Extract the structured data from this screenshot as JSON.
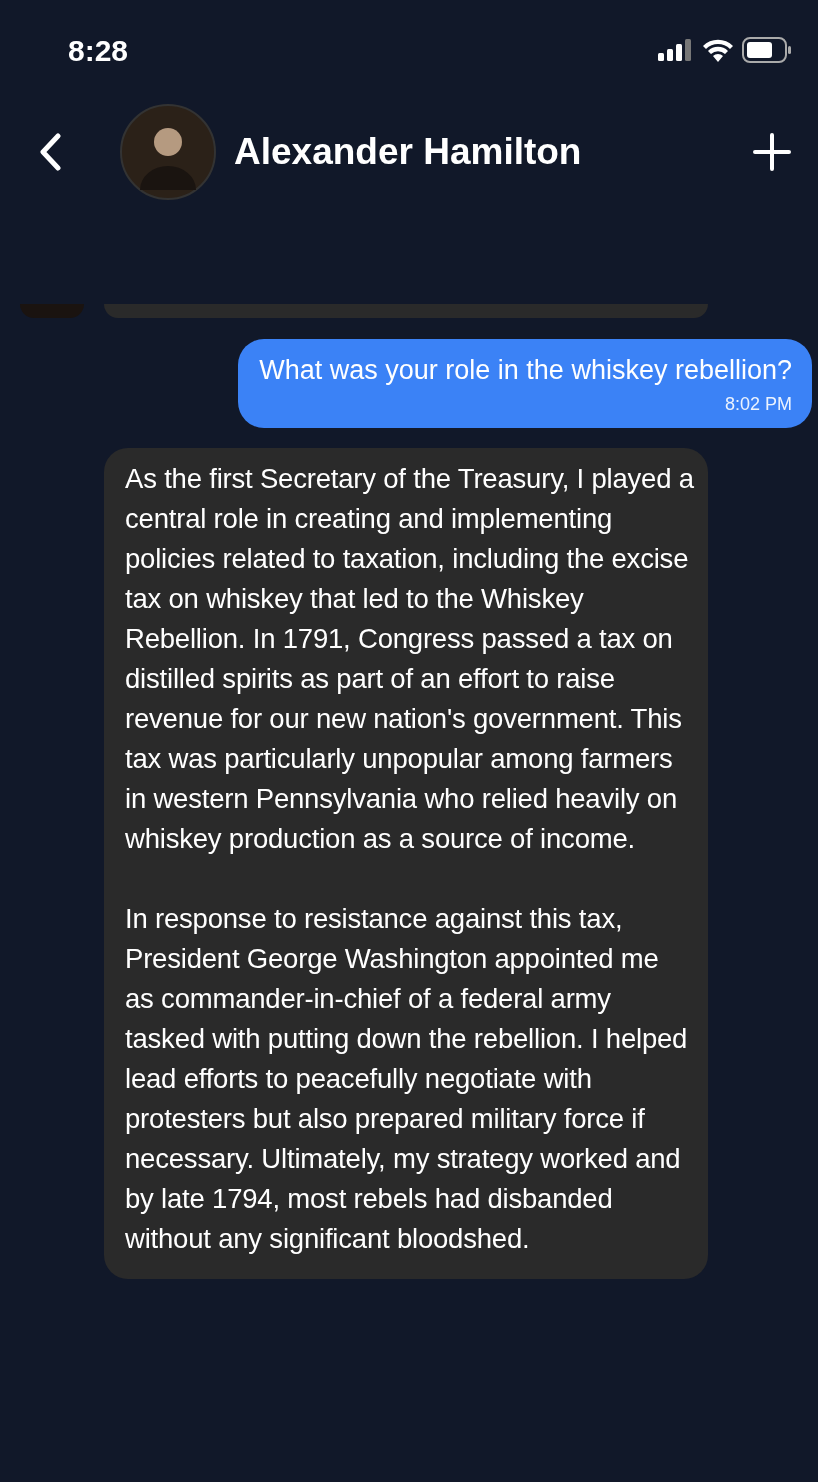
{
  "status_bar": {
    "time": "8:28"
  },
  "header": {
    "title": "Alexander Hamilton"
  },
  "messages": [
    {
      "kind": "partial"
    },
    {
      "kind": "sent",
      "text": "What was your role in the whiskey rebellion?",
      "time": "8:02 PM"
    },
    {
      "kind": "received",
      "paragraphs": [
        "As the first Secretary of the Treasury, I played a central role in creating and implementing policies related to taxation, including the excise tax on whiskey that led to the Whiskey Rebellion. In 1791, Congress passed a tax on distilled spirits as part of an effort to raise revenue for our new nation's government. This tax was particularly unpopular among farmers in western Pennsylvania who relied heavily on whiskey production as a source of income.",
        "In response to resistance against this tax, President George Washington appointed me as commander-in-chief of a federal army tasked with putting down the rebellion. I helped lead efforts to peacefully negotiate with protesters but also prepared military force if necessary. Ultimately, my strategy worked and by late 1794, most rebels had disbanded without any significant bloodshed."
      ]
    }
  ]
}
